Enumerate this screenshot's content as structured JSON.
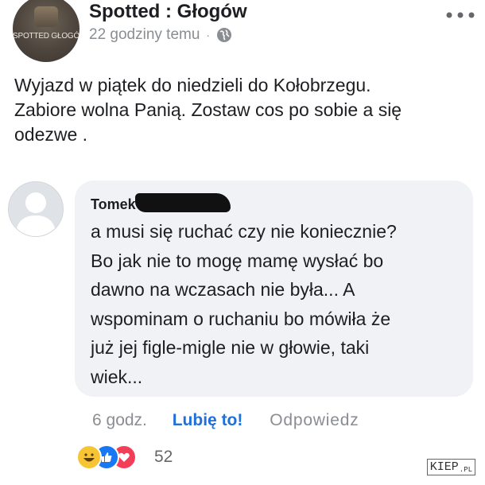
{
  "post": {
    "page_name": "Spotted : Głogów",
    "avatar_text": "SPOTTED GŁOGÓW",
    "time": "22 godziny temu",
    "separator": "·",
    "privacy_icon": "globe-icon",
    "menu_icon": "more-icon",
    "text_lines": [
      "Wyjazd w piątek do niedzieli do Kołobrzegu.",
      "Zabiore wolna Panią.  Zostaw cos po sobie a się",
      "odezwe ."
    ]
  },
  "comment": {
    "author": "Tomek",
    "text_lines": [
      "a musi się ruchać czy nie koniecznie?",
      "Bo jak nie to mogę mamę wysłać bo",
      "dawno na wczasach nie była... A",
      "wspominam o ruchaniu bo mówiła że",
      "już jej figle-migle nie w głowie, taki",
      "wiek..."
    ],
    "time": "6 godz.",
    "like_label": "Lubię to!",
    "reply_label": "Odpowiedz",
    "reaction_count": "52",
    "reaction_icons": [
      "haha-icon",
      "like-icon",
      "love-icon"
    ]
  },
  "watermark": {
    "main": "KIEP",
    "suffix": ".PL"
  },
  "colors": {
    "link_blue": "#216fdb",
    "meta_gray": "#8a8d91",
    "bubble": "#f0f2f5"
  }
}
